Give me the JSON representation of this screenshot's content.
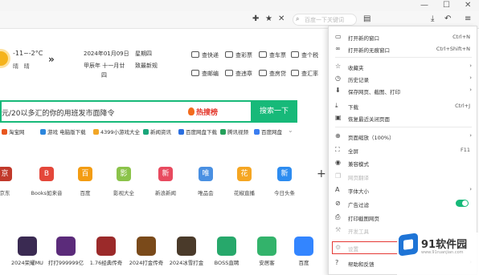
{
  "toolbar": {
    "search_placeholder": "百度一下关键词",
    "icons": [
      "extension-icon",
      "favorites-icon",
      "tools-icon",
      "search-icon",
      "clipboard-icon",
      "download-icon",
      "undo-icon",
      "menu-icon"
    ]
  },
  "weather": {
    "temp": "-11~-2°C",
    "desc": "晴",
    "desc2": "晴"
  },
  "date": {
    "date": "2024年01月09日",
    "week": "星期四",
    "lunar1": "甲辰年",
    "lunar2": "十一月廿",
    "lunar3": "四",
    "extra": "致最新规"
  },
  "quick_links": [
    {
      "label": "查快递"
    },
    {
      "label": "查彩票"
    },
    {
      "label": "查车票"
    },
    {
      "label": "查个税"
    },
    {
      "label": "查邮编"
    },
    {
      "label": "查违章"
    },
    {
      "label": "查房贷"
    },
    {
      "label": "查汇率"
    }
  ],
  "search": {
    "query": "元/20以多汇的你的用班发市面降令",
    "hot_label": "热搜榜",
    "button_label": "搜索一下"
  },
  "bookmarks": [
    {
      "label": "淘宝网",
      "color": "#e8561f"
    },
    {
      "label": "游戏 电脑版下载",
      "color": "#2c86dd"
    },
    {
      "label": "4399小游戏大全",
      "color": "#f2a626"
    },
    {
      "label": "新闻资讯",
      "color": "#1aa67a"
    },
    {
      "label": "百度网盘下载",
      "color": "#2a6fe0"
    },
    {
      "label": "腾讯视频",
      "color": "#25a05a"
    },
    {
      "label": "百度网盘",
      "color": "#3a7df0"
    }
  ],
  "sites": [
    {
      "tile": "京",
      "label": "京东",
      "color": "#c1392b"
    },
    {
      "tile": "B",
      "label": "Books如来音",
      "color": "#e4473a"
    },
    {
      "tile": "百",
      "label": "百度",
      "color": "#f39c12"
    },
    {
      "tile": "影",
      "label": "影视大全",
      "color": "#8bc34a"
    },
    {
      "tile": "新",
      "label": "新浪新闻",
      "color": "#e84a5f"
    },
    {
      "tile": "唯",
      "label": "唯品会",
      "color": "#4a90e2"
    },
    {
      "tile": "花",
      "label": "花椒直播",
      "color": "#f5a623"
    },
    {
      "tile": "新",
      "label": "今日头条",
      "color": "#2d8cf0"
    }
  ],
  "add_label": "+",
  "games": [
    {
      "label": "2024荣耀MU",
      "color": "#3a2a52"
    },
    {
      "label": "打打999999亿",
      "color": "#5b2b7a"
    },
    {
      "label": "1.76经典传奇",
      "color": "#9b2a2a"
    },
    {
      "label": "2024打金传奇",
      "color": "#7a4a1a"
    },
    {
      "label": "2024冰雪打金",
      "color": "#4a3a2a"
    },
    {
      "label": "BOSS直聘",
      "color": "#27a86b"
    },
    {
      "label": "安居客",
      "color": "#33b36b"
    },
    {
      "label": "百度",
      "color": "#3385ff"
    }
  ],
  "menu": {
    "items": [
      {
        "icon": "new-window-icon",
        "label": "打开新的窗口",
        "shortcut": "Ctrl+N"
      },
      {
        "icon": "incognito-icon",
        "label": "打开新的无痕窗口",
        "shortcut": "Ctrl+Shift+N"
      },
      {
        "icon": "favorites-icon",
        "label": "收藏夹",
        "arrow": "›"
      },
      {
        "icon": "history-icon",
        "label": "历史记录",
        "arrow": "›"
      },
      {
        "icon": "save-icon",
        "label": "保存网页、截图、打印",
        "arrow": "›"
      },
      {
        "icon": "download-icon",
        "label": "下载",
        "shortcut": "Ctrl+J"
      },
      {
        "icon": "restore-icon",
        "label": "恢复最近关闭页面"
      },
      {
        "icon": "zoom-icon",
        "label": "页面缩放（100%）",
        "arrow": "›"
      },
      {
        "icon": "fullscreen-icon",
        "label": "全屏",
        "shortcut": "F11"
      },
      {
        "icon": "compat-icon",
        "label": "兼容模式"
      },
      {
        "icon": "copy-icon",
        "label": "网页翻译"
      },
      {
        "icon": "font-icon",
        "label": "字体大小",
        "arrow": "›"
      },
      {
        "icon": "adblock-icon",
        "label": "广告过滤"
      },
      {
        "icon": "print-icon",
        "label": "打印截图网页"
      },
      {
        "icon": "dev-icon",
        "label": "开发工具"
      },
      {
        "icon": "settings-icon",
        "label": "设置"
      },
      {
        "icon": "help-icon",
        "label": "帮助和反馈",
        "arrow": "›"
      }
    ]
  },
  "watermark": {
    "title": "91软件园",
    "url": "www.91ruanjian.com"
  }
}
